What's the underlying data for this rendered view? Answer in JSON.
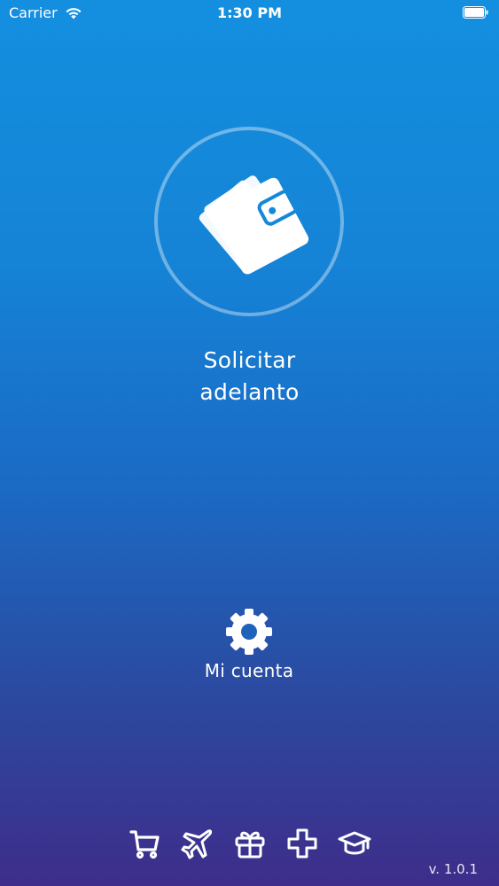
{
  "status_bar": {
    "carrier": "Carrier",
    "time": "1:30 PM"
  },
  "main_action": {
    "icon": "wallet-icon",
    "label_line1": "Solicitar",
    "label_line2": "adelanto"
  },
  "account": {
    "icon": "gear-icon",
    "label": "Mi cuenta"
  },
  "bottom_icons": [
    "cart-icon",
    "airplane-icon",
    "gift-icon",
    "plus-icon",
    "graduation-cap-icon"
  ],
  "version": "v. 1.0.1",
  "colors": {
    "gradient_top": "#148fdf",
    "gradient_bottom": "#3e2d8a",
    "icon_dark": "#1688d8"
  }
}
